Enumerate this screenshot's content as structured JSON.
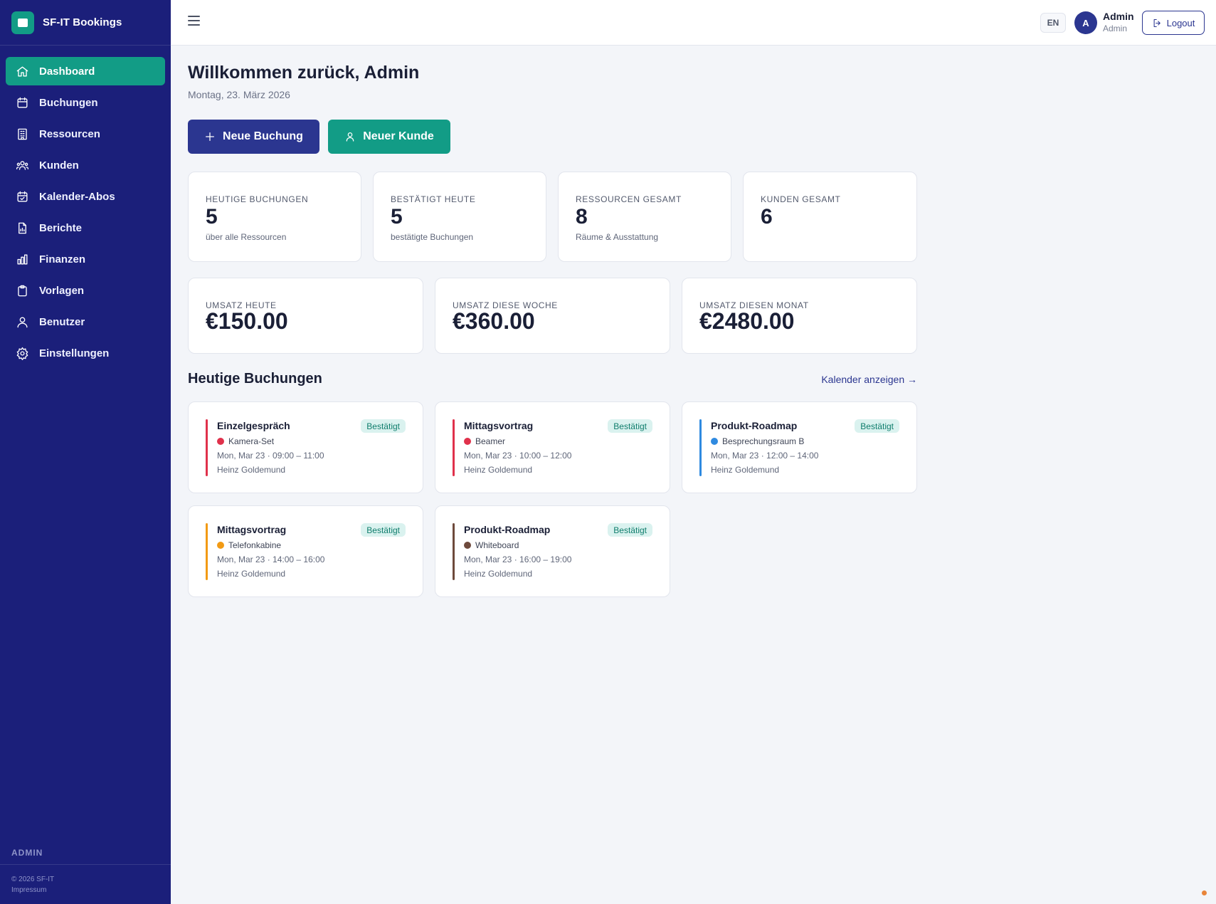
{
  "app": {
    "name": "SF-IT Bookings"
  },
  "sidebar": {
    "items": [
      {
        "label": "Dashboard",
        "icon": "home-icon",
        "active": true
      },
      {
        "label": "Buchungen",
        "icon": "calendar-icon"
      },
      {
        "label": "Ressourcen",
        "icon": "building-icon"
      },
      {
        "label": "Kunden",
        "icon": "users-icon"
      },
      {
        "label": "Kalender-Abos",
        "icon": "calendar-check-icon"
      },
      {
        "label": "Berichte",
        "icon": "report-icon"
      },
      {
        "label": "Finanzen",
        "icon": "bar-chart-icon"
      },
      {
        "label": "Vorlagen",
        "icon": "clipboard-icon"
      },
      {
        "label": "Benutzer",
        "icon": "user-icon"
      },
      {
        "label": "Einstellungen",
        "icon": "gear-icon"
      }
    ],
    "role": "ADMIN",
    "copyright": "© 2026 SF-IT",
    "imprint": "Impressum"
  },
  "header": {
    "lang": "EN",
    "avatar_initial": "A",
    "user_name": "Admin",
    "user_role": "Admin",
    "logout_label": "Logout"
  },
  "main": {
    "title": "Willkommen zurück, Admin",
    "date": "Montag, 23. März 2026",
    "new_booking_label": "Neue Buchung",
    "new_customer_label": "Neuer Kunde",
    "stats": [
      {
        "label": "Heutige Buchungen",
        "value": "5",
        "sub": "über alle Ressourcen"
      },
      {
        "label": "Bestätigt heute",
        "value": "5",
        "sub": "bestätigte Buchungen"
      },
      {
        "label": "Ressourcen gesamt",
        "value": "8",
        "sub": "Räume & Ausstattung"
      },
      {
        "label": "Kunden gesamt",
        "value": "6",
        "sub": ""
      }
    ],
    "revenue": [
      {
        "label": "Umsatz heute",
        "value": "€150.00"
      },
      {
        "label": "Umsatz diese Woche",
        "value": "€360.00"
      },
      {
        "label": "Umsatz diesen Monat",
        "value": "€2480.00"
      }
    ],
    "section_title": "Heutige Buchungen",
    "calendar_link": "Kalender anzeigen →",
    "bookings": [
      {
        "title": "Einzelgespräch",
        "status": "Bestätigt",
        "resource": "Kamera-Set",
        "color": "#e0314b",
        "time": "Mon, Mar 23 · 09:00 – 11:00",
        "customer": "Heinz Goldemund"
      },
      {
        "title": "Mittagsvortrag",
        "status": "Bestätigt",
        "resource": "Beamer",
        "color": "#e0314b",
        "time": "Mon, Mar 23 · 10:00 – 12:00",
        "customer": "Heinz Goldemund"
      },
      {
        "title": "Produkt-Roadmap",
        "status": "Bestätigt",
        "resource": "Besprechungsraum B",
        "color": "#2f8ae0",
        "time": "Mon, Mar 23 · 12:00 – 14:00",
        "customer": "Heinz Goldemund"
      },
      {
        "title": "Mittagsvortrag",
        "status": "Bestätigt",
        "resource": "Telefonkabine",
        "color": "#f29a14",
        "time": "Mon, Mar 23 · 14:00 – 16:00",
        "customer": "Heinz Goldemund"
      },
      {
        "title": "Produkt-Roadmap",
        "status": "Bestätigt",
        "resource": "Whiteboard",
        "color": "#6e4a3c",
        "time": "Mon, Mar 23 · 16:00 – 19:00",
        "customer": "Heinz Goldemund"
      }
    ]
  }
}
